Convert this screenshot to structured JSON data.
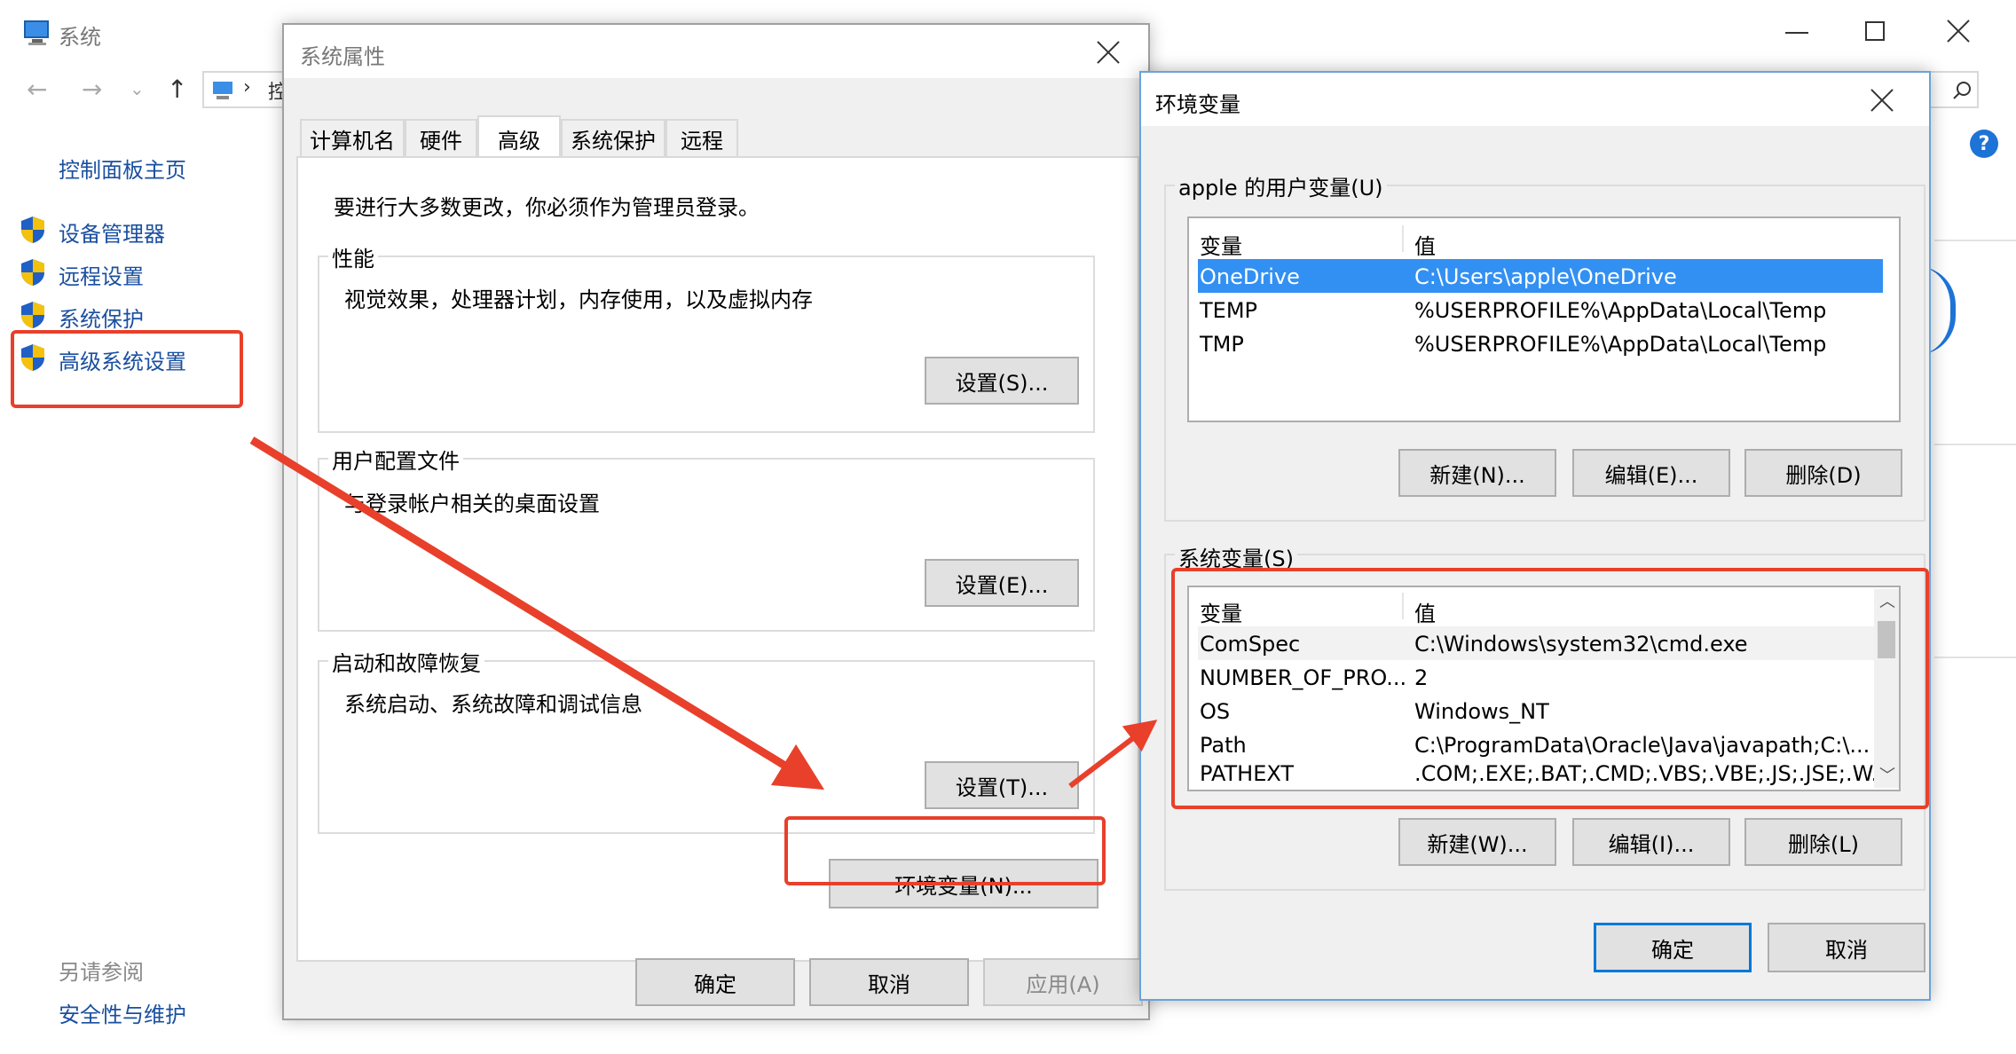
{
  "colors": {
    "accent": "#0078d7",
    "selection": "#3390f3",
    "annotation_red": "#e8402b",
    "help_blue": "#1e73d6"
  },
  "bg_window": {
    "title": "系统",
    "nav": {
      "back_icon": "arrow-left-icon",
      "forward_icon": "arrow-right-icon",
      "up_icon": "arrow-up-icon",
      "breadcrumb_fragment": "控"
    },
    "sidebar": {
      "home": "控制面板主页",
      "items": [
        {
          "label": "设备管理器",
          "icon": "shield-icon"
        },
        {
          "label": "远程设置",
          "icon": "shield-icon"
        },
        {
          "label": "系统保护",
          "icon": "shield-icon"
        },
        {
          "label": "高级系统设置",
          "icon": "shield-icon"
        }
      ],
      "see_also_title": "另请参阅",
      "see_also_item": "安全性与维护"
    },
    "controls": {
      "minimize_icon": "minimize-icon",
      "maximize_icon": "maximize-icon",
      "close_icon": "close-icon",
      "search_icon": "search-icon",
      "help_icon": "help-icon"
    }
  },
  "sys_props": {
    "title": "系统属性",
    "tabs": [
      "计算机名",
      "硬件",
      "高级",
      "系统保护",
      "远程"
    ],
    "active_tab": "高级",
    "admin_note": "要进行大多数更改，你必须作为管理员登录。",
    "performance": {
      "title": "性能",
      "desc": "视觉效果，处理器计划，内存使用，以及虚拟内存",
      "button": "设置(S)..."
    },
    "user_profiles": {
      "title": "用户配置文件",
      "desc": "与登录帐户相关的桌面设置",
      "button": "设置(E)..."
    },
    "startup": {
      "title": "启动和故障恢复",
      "desc": "系统启动、系统故障和调试信息",
      "button": "设置(T)..."
    },
    "env_button": "环境变量(N)...",
    "ok": "确定",
    "cancel": "取消",
    "apply": "应用(A)"
  },
  "env_vars": {
    "title": "环境变量",
    "user_section": "apple 的用户变量(U)",
    "col_var": "变量",
    "col_val": "值",
    "user_rows": [
      {
        "name": "OneDrive",
        "value": "C:\\Users\\apple\\OneDrive",
        "selected": true
      },
      {
        "name": "TEMP",
        "value": "%USERPROFILE%\\AppData\\Local\\Temp",
        "selected": false
      },
      {
        "name": "TMP",
        "value": "%USERPROFILE%\\AppData\\Local\\Temp",
        "selected": false
      }
    ],
    "user_buttons": {
      "new": "新建(N)...",
      "edit": "编辑(E)...",
      "delete": "删除(D)"
    },
    "sys_section": "系统变量(S)",
    "sys_rows": [
      {
        "name": "ComSpec",
        "value": "C:\\Windows\\system32\\cmd.exe"
      },
      {
        "name": "NUMBER_OF_PRO...",
        "value": "2"
      },
      {
        "name": "OS",
        "value": "Windows_NT"
      },
      {
        "name": "Path",
        "value": "C:\\ProgramData\\Oracle\\Java\\javapath;C:\\..."
      },
      {
        "name": "PATHEXT",
        "value": ".COM;.EXE;.BAT;.CMD;.VBS;.VBE;.JS;.JSE;.W..."
      }
    ],
    "sys_buttons": {
      "new": "新建(W)...",
      "edit": "编辑(I)...",
      "delete": "删除(L)"
    },
    "ok": "确定",
    "cancel": "取消"
  }
}
